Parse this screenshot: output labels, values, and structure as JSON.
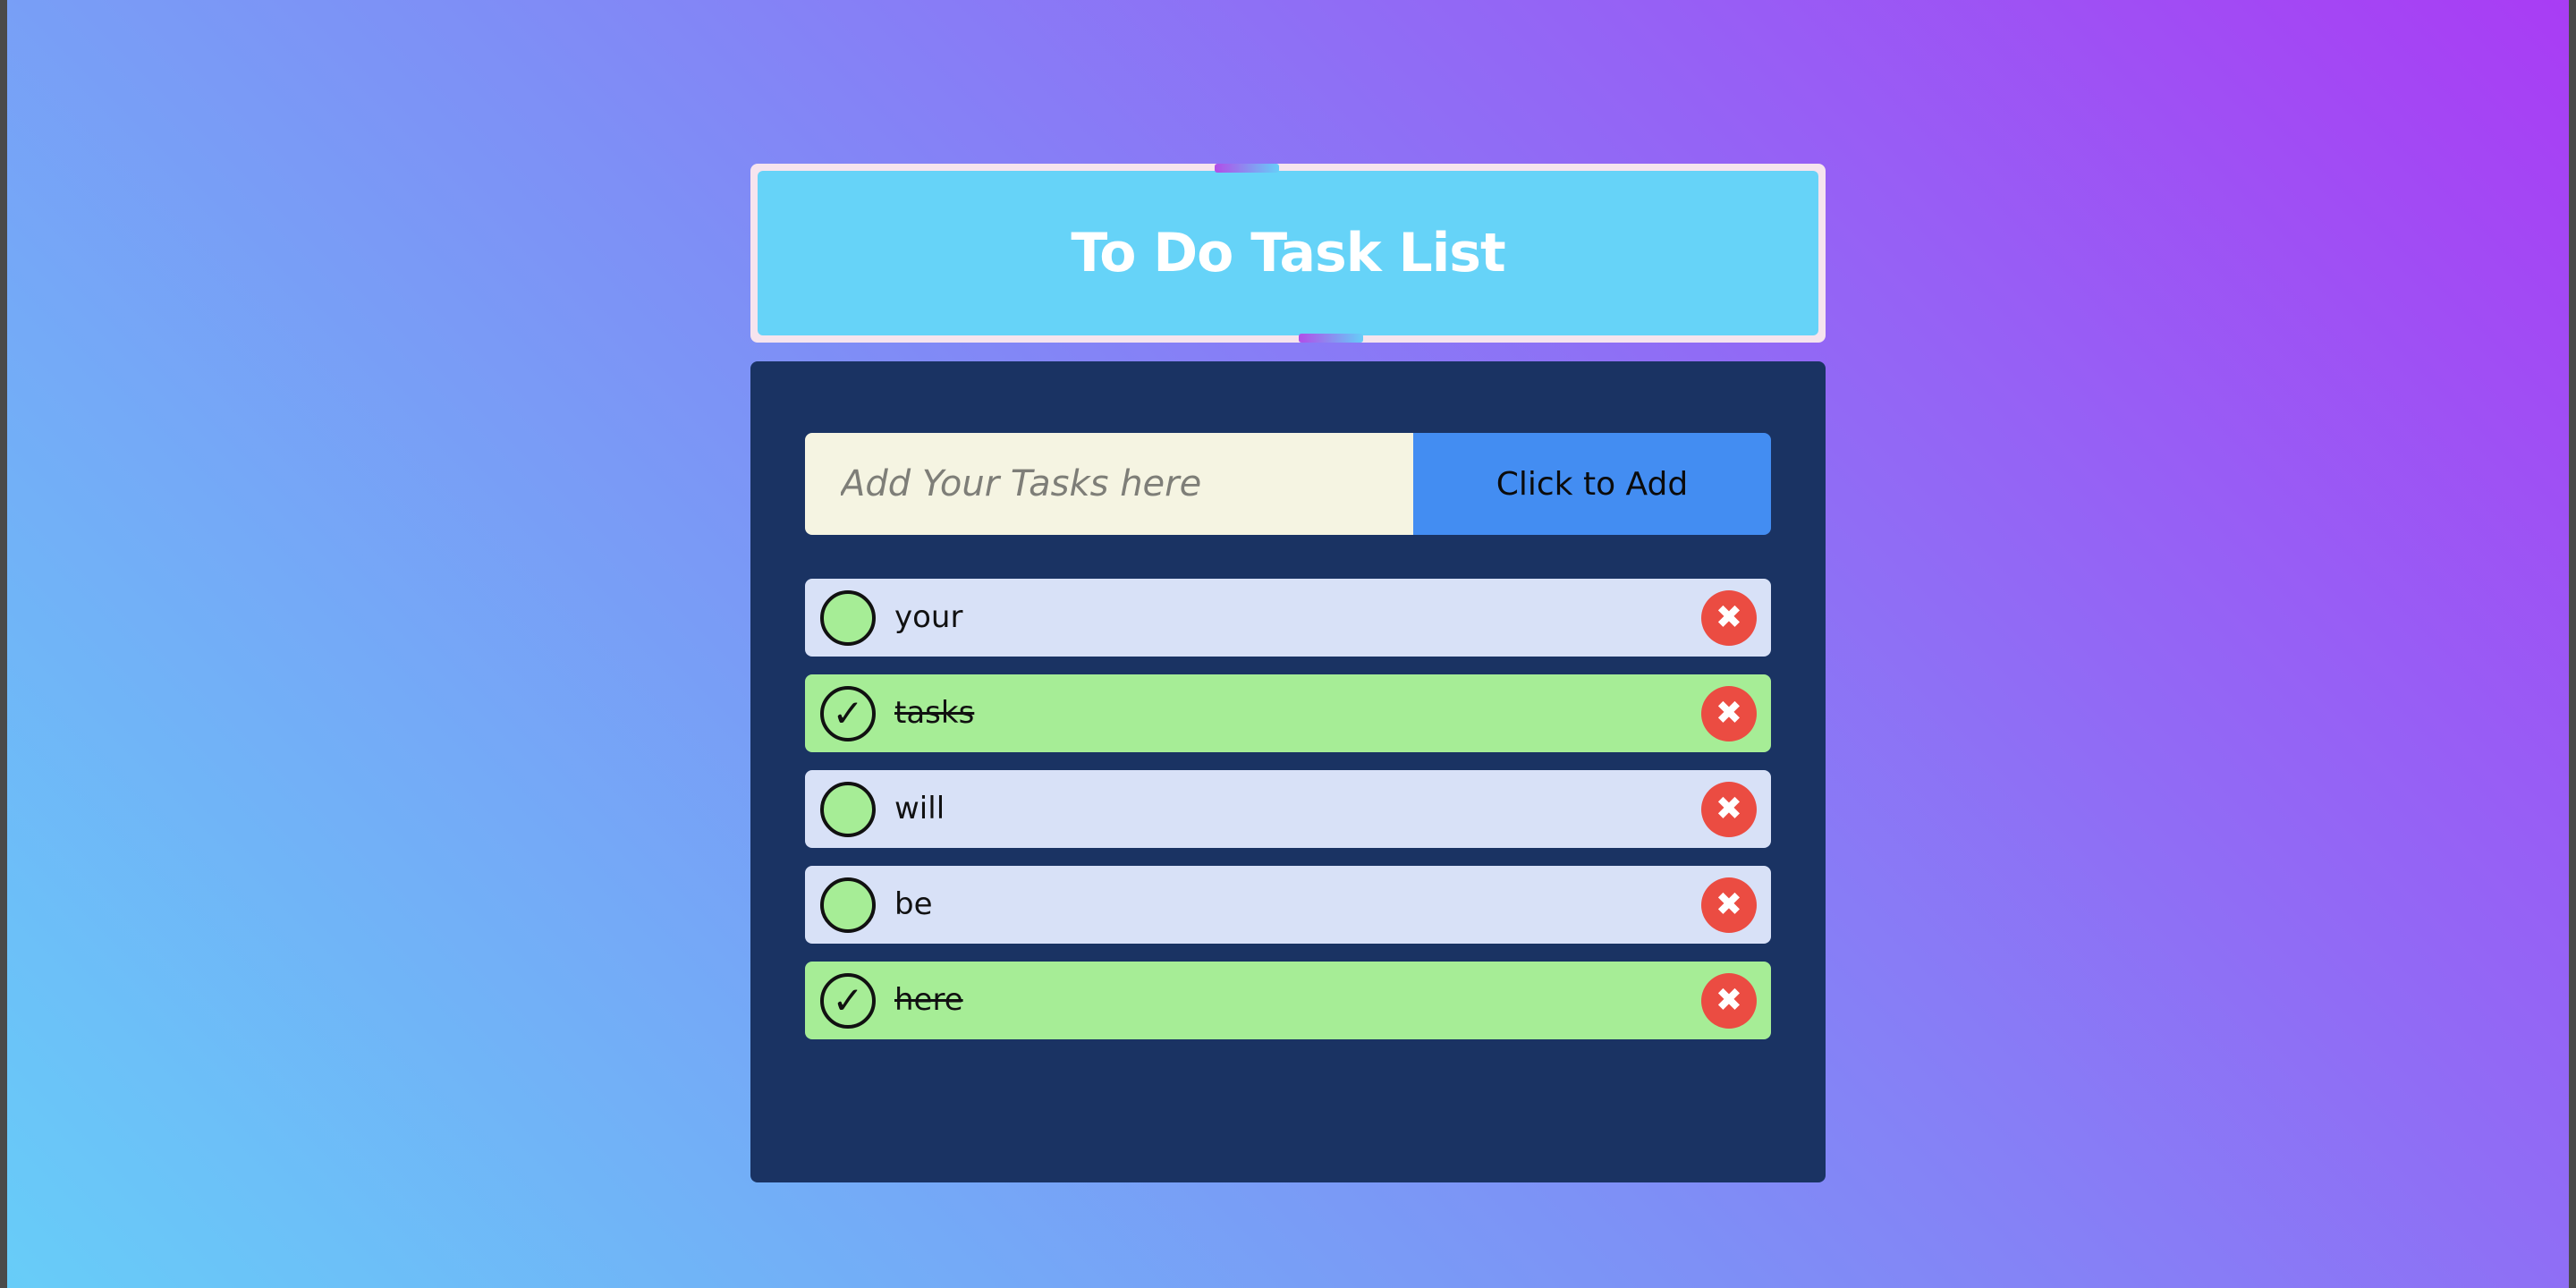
{
  "header": {
    "title": "To Do Task List"
  },
  "form": {
    "placeholder": "Add Your Tasks here",
    "value": "",
    "add_button_label": "Click to Add"
  },
  "tasks": [
    {
      "text": "your",
      "done": false
    },
    {
      "text": "tasks",
      "done": true
    },
    {
      "text": "will",
      "done": false
    },
    {
      "text": "be",
      "done": false
    },
    {
      "text": "here",
      "done": true
    }
  ],
  "icons": {
    "check": "checkmark-icon",
    "delete": "close-icon",
    "check_glyph": "✓",
    "delete_glyph": "✖"
  },
  "colors": {
    "background_start": "#67cdf8",
    "background_end": "#a93cf4",
    "header": "#66d3f8",
    "panel": "#1a3363",
    "input": "#f5f4e2",
    "add_button": "#438df2",
    "task_pending": "#d8e1f7",
    "task_done": "#a6ed96",
    "delete": "#eb4c42"
  }
}
